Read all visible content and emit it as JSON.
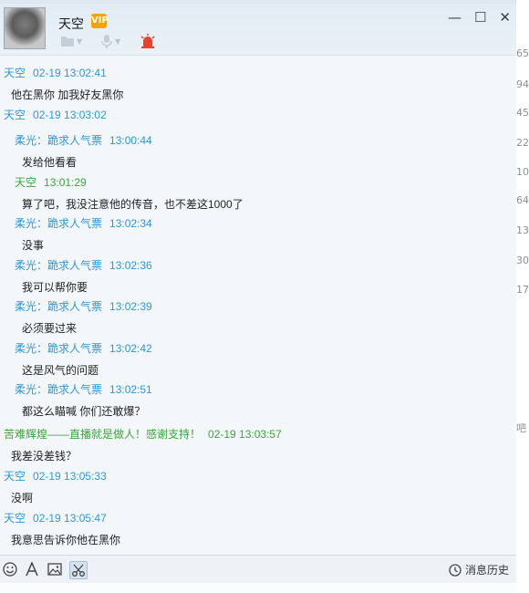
{
  "window": {
    "title": "天空",
    "vip_badge": "VIP"
  },
  "background_snippets": [
    "65",
    "94",
    "45",
    "22",
    "10",
    "64",
    "13",
    "30",
    "17",
    "吧"
  ],
  "messages": [
    {
      "sender": "天空",
      "time": "02-19 13:02:41",
      "text": "他在黑你 加我好友黑你",
      "indent": 0,
      "color": "blue"
    },
    {
      "sender": "天空",
      "time": "02-19 13:03:02",
      "text": "",
      "indent": 0,
      "color": "blue"
    },
    {
      "sender": "柔光：跪求人气票",
      "time": "13:00:44",
      "text": "发给他看看",
      "indent": 1,
      "color": "blue"
    },
    {
      "sender": "天空",
      "time": "13:01:29",
      "text": "算了吧，我没注意他的传音，也不差这1000了",
      "indent": 1,
      "color": "green"
    },
    {
      "sender": "柔光：跪求人气票",
      "time": "13:02:34",
      "text": "没事",
      "indent": 1,
      "color": "blue"
    },
    {
      "sender": "柔光：跪求人气票",
      "time": "13:02:36",
      "text": "我可以帮你要",
      "indent": 1,
      "color": "blue"
    },
    {
      "sender": "柔光：跪求人气票",
      "time": "13:02:39",
      "text": "必须要过来",
      "indent": 1,
      "color": "blue"
    },
    {
      "sender": "柔光：跪求人气票",
      "time": "13:02:42",
      "text": "这是风气的问题",
      "indent": 1,
      "color": "blue"
    },
    {
      "sender": "柔光：跪求人气票",
      "time": "13:02:51",
      "text": "都这么瞄喊 你们还敢爆？",
      "indent": 1,
      "color": "blue"
    },
    {
      "sender": "苦难辉煌——直播就是做人！感谢支持！",
      "time": "02-19 13:03:57",
      "text": "我差没差钱？",
      "indent": 0,
      "color": "green"
    },
    {
      "sender": "天空",
      "time": "02-19 13:05:33",
      "text": "没啊",
      "indent": 0,
      "color": "blue"
    },
    {
      "sender": "天空",
      "time": "02-19 13:05:47",
      "text": "我意思告诉你他在黑你",
      "indent": 0,
      "color": "blue"
    }
  ],
  "toolbar": {
    "history_label": "消息历史"
  },
  "colors": {
    "sender_blue": "#2e97d6",
    "sender_green": "#3aa63a",
    "alert_red": "#e8432b"
  }
}
